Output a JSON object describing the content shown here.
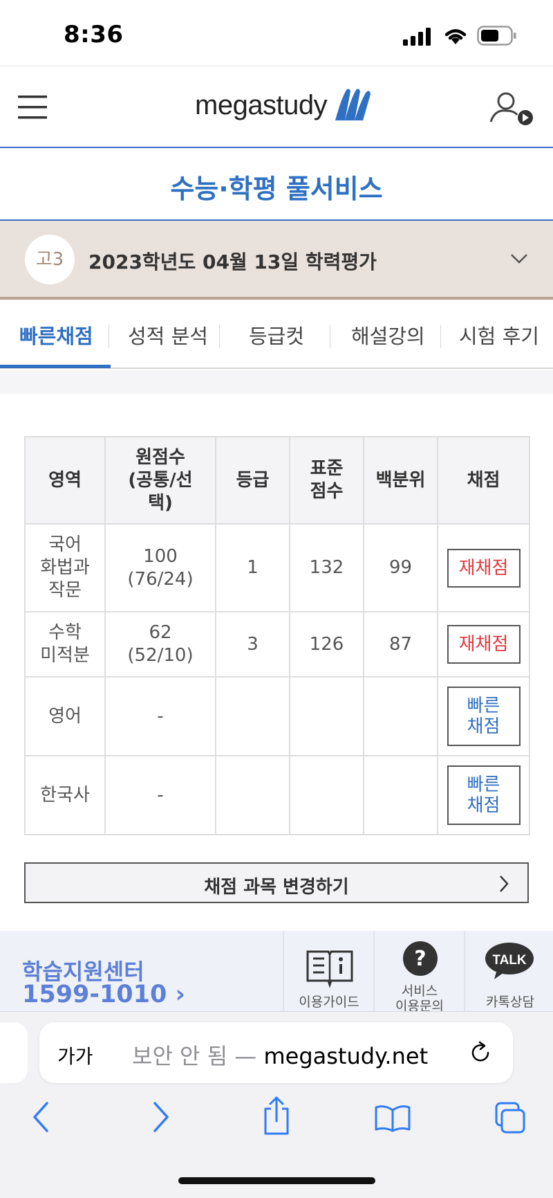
{
  "status_bar": {
    "time": "8:36"
  },
  "header": {
    "logo_text": "megastudy"
  },
  "service": {
    "title": "수능·학평 풀서비스"
  },
  "exam": {
    "grade_badge": "고3",
    "label": "2023학년도 04월 13일 학력평가"
  },
  "tabs": [
    {
      "label": "빠른채점",
      "active": true
    },
    {
      "label": "성적 분석",
      "active": false
    },
    {
      "label": "등급컷",
      "active": false
    },
    {
      "label": "해설강의",
      "active": false
    },
    {
      "label": "시험 후기",
      "active": false
    }
  ],
  "table": {
    "headers": {
      "area": "영역",
      "raw_line1": "원점수",
      "raw_line2": "(공통/선",
      "raw_line3": "택)",
      "grade": "등급",
      "std_line1": "표준",
      "std_line2": "점수",
      "percentile": "백분위",
      "action": "채점"
    },
    "rows": [
      {
        "area_lines": [
          "국어",
          "화법과",
          "작문"
        ],
        "raw": "100",
        "raw_split": "(76/24)",
        "grade": "1",
        "std": "132",
        "pct": "99",
        "action": "재채점"
      },
      {
        "area_lines": [
          "수학",
          "미적분"
        ],
        "raw": "62",
        "raw_split": "(52/10)",
        "grade": "3",
        "std": "126",
        "pct": "87",
        "action": "재채점"
      },
      {
        "area_lines": [
          "영어"
        ],
        "raw": "-",
        "raw_split": "",
        "grade": "",
        "std": "",
        "pct": "",
        "action_line1": "빠른",
        "action_line2": "채점"
      },
      {
        "area_lines": [
          "한국사"
        ],
        "raw": "-",
        "raw_split": "",
        "grade": "",
        "std": "",
        "pct": "",
        "action_line1": "빠른",
        "action_line2": "채점"
      }
    ]
  },
  "change_subjects": {
    "label": "채점 과목 변경하기"
  },
  "support": {
    "title": "학습지원센터",
    "phone": "1599-1010 ›",
    "guide_label": "이용가이드",
    "service_line1": "서비스",
    "service_line2": "이용문의",
    "kakao_badge": "TALK",
    "kakao_label": "카톡상담"
  },
  "browser": {
    "aa": "가가",
    "insecure": "보안 안 됨 —",
    "domain": "megastudy.net"
  },
  "colors": {
    "brand_blue": "#2f70c3",
    "rescore_red": "#e0393e",
    "exam_bar": "#e9e1db"
  }
}
